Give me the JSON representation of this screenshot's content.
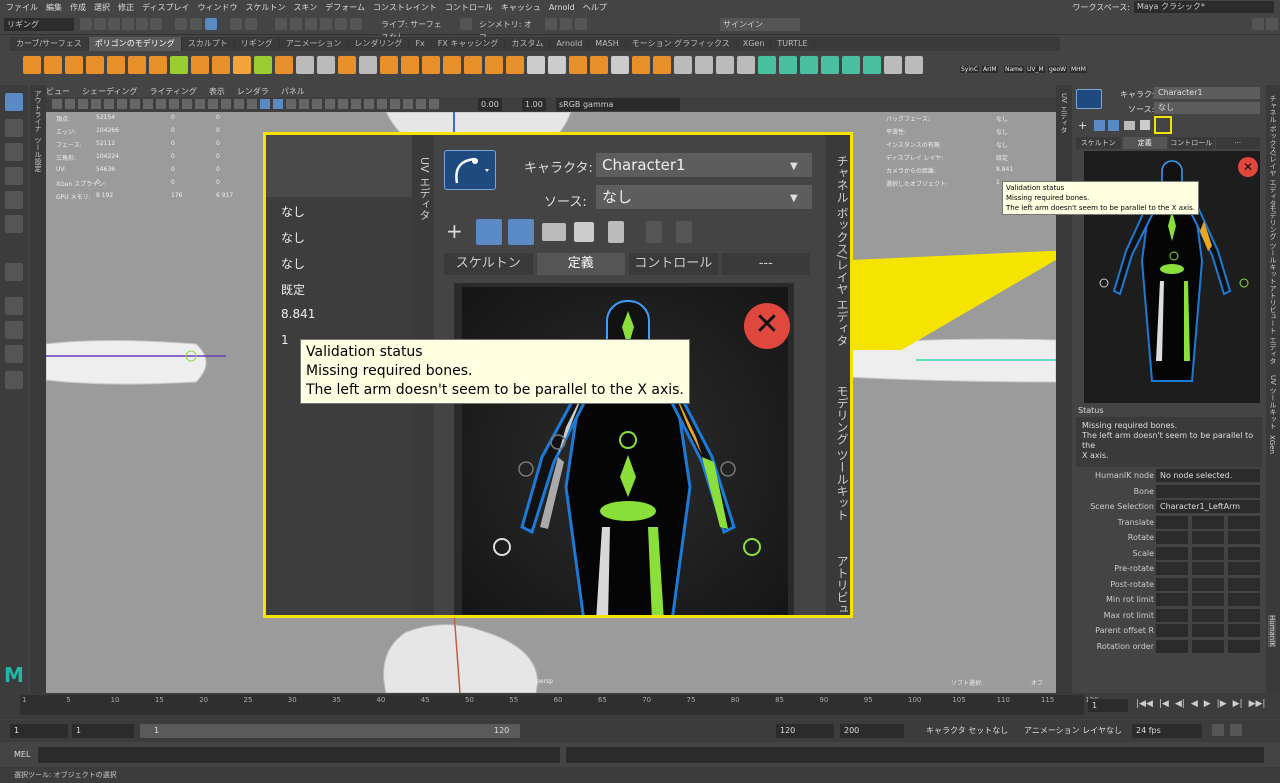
{
  "menubar": {
    "items": [
      "ファイル",
      "編集",
      "作成",
      "選択",
      "修正",
      "ディスプレイ",
      "ウィンドウ",
      "スケルトン",
      "スキン",
      "デフォーム",
      "コンストレイント",
      "コントロール",
      "キャッシュ",
      "Arnold",
      "ヘルプ"
    ],
    "workspace_label": "ワークスペース:",
    "workspace_value": "Maya クラシック*"
  },
  "statusline": {
    "mode": "リギング",
    "live": "ライブ: サーフェスなし",
    "symmetry": "シンメトリ: オフ",
    "signin": "サインイン"
  },
  "shelf": {
    "tabs": [
      "カーブ/サーフェス",
      "ポリゴンのモデリング",
      "スカルプト",
      "リギング",
      "アニメーション",
      "レンダリング",
      "Fx",
      "FX キャッシング",
      "カスタム",
      "Arnold",
      "MASH",
      "モーション グラフィックス",
      "XGen",
      "TURTLE"
    ],
    "active": "ポリゴンのモデリング",
    "labels": [
      "SyinC",
      "ArIM",
      "Name",
      "UV_M",
      "geoW",
      "MHM"
    ]
  },
  "panel": {
    "menu": [
      "ビュー",
      "シェーディング",
      "ライティング",
      "表示",
      "レンダラ",
      "パネル"
    ],
    "val1": "0.00",
    "val2": "1.00",
    "colorspace": "sRGB gamma",
    "camera": "persp",
    "soft_label": "ソフト選択:",
    "soft_value": "オフ"
  },
  "hud": {
    "left": [
      [
        "頂点:",
        "52154",
        "0",
        "0"
      ],
      [
        "エッジ:",
        "104266",
        "0",
        "0"
      ],
      [
        "フェース:",
        "52112",
        "0",
        "0"
      ],
      [
        "三角形:",
        "104224",
        "0",
        "0"
      ],
      [
        "UV:",
        "54636",
        "0",
        "0"
      ],
      [
        "XGen スプライン:",
        "0",
        "0",
        "0"
      ],
      [
        "GPU メモリ:",
        "8 192",
        "176",
        "6 917"
      ]
    ],
    "right": [
      [
        "バックフェース:",
        "なし"
      ],
      [
        "平滑性:",
        "なし"
      ],
      [
        "インスタンスの有無:",
        "なし"
      ],
      [
        "ディスプレイ レイヤ:",
        "既定"
      ],
      [
        "カメラからの距離:",
        "8.841"
      ],
      [
        "選択したオブジェクト:",
        "1"
      ]
    ]
  },
  "zoom": {
    "values": [
      "なし",
      "なし",
      "なし",
      "既定",
      "8.841",
      "1"
    ],
    "uv_tab": "UV エディタ",
    "char_label": "キャラクタ:",
    "char_value": "Character1",
    "source_label": "ソース:",
    "source_value": "なし",
    "tabs": [
      "スケルトン",
      "定義",
      "コントロール",
      "---"
    ],
    "side_tabs": [
      "チャネル ボックス/レイヤ エディタ",
      "モデリング ツールキット",
      "アトリビュ"
    ],
    "tooltip": [
      "Validation status",
      "Missing required bones.",
      "The left arm doesn't seem to be parallel to the X axis."
    ]
  },
  "hik": {
    "char_label": "キャラクタ:",
    "char_value": "Character1",
    "source_label": "ソース:",
    "source_value": "なし",
    "tabs": [
      "スケルトン",
      "定義",
      "コントロール",
      "···"
    ],
    "tooltip": [
      "Validation status",
      "Missing required bones.",
      "The left arm doesn't seem to be parallel to the X axis."
    ],
    "status_title": "Status",
    "status_text": [
      "Missing required bones.",
      "The left arm doesn't seem to be parallel to the",
      "X axis."
    ],
    "props": [
      {
        "label": "HumanIK node",
        "value": "No node selected."
      },
      {
        "label": "Bone",
        "value": ""
      },
      {
        "label": "Scene Selection",
        "value": "Character1_LeftArm"
      },
      {
        "label": "Translate",
        "value": ""
      },
      {
        "label": "Rotate",
        "value": ""
      },
      {
        "label": "Scale",
        "value": ""
      },
      {
        "label": "Pre-rotate",
        "value": ""
      },
      {
        "label": "Post-rotate",
        "value": ""
      },
      {
        "label": "Min rot limit",
        "value": ""
      },
      {
        "label": "Max rot limit",
        "value": ""
      },
      {
        "label": "Parent offset R",
        "value": ""
      },
      {
        "label": "Rotation order",
        "value": ""
      }
    ]
  },
  "side_tabs_right": [
    "チャネル ボックス/レイヤ エディタ",
    "モデリング ツールキット",
    "アトリビュート エディタ",
    "UV ツールキット",
    "XGen",
    "HumanIK"
  ],
  "left_strip": [
    "アウトライナ",
    "ツール設定"
  ],
  "right_strip": [
    "UV エディタ"
  ],
  "timeline": {
    "ticks": [
      "1",
      "5",
      "10",
      "15",
      "20",
      "25",
      "30",
      "35",
      "40",
      "45",
      "50",
      "55",
      "60",
      "65",
      "70",
      "75",
      "80",
      "85",
      "90",
      "95",
      "100",
      "105",
      "110",
      "115",
      "120"
    ],
    "current": "1"
  },
  "range": {
    "start": "1",
    "start2": "1",
    "range_start": "1",
    "range_end": "120",
    "end": "120",
    "end2": "200",
    "char_set": "キャラクタ セットなし",
    "anim_layer": "アニメーション レイヤなし",
    "fps": "24 fps"
  },
  "mel": {
    "label": "MEL"
  },
  "help": {
    "text": "選択ツール: オブジェクトの選択"
  },
  "colors": {
    "highlight": "#f5e400",
    "accent": "#5a8ac6",
    "error": "#e0483d",
    "bone_green": "#8adf3a",
    "bone_orange": "#e8a623"
  }
}
